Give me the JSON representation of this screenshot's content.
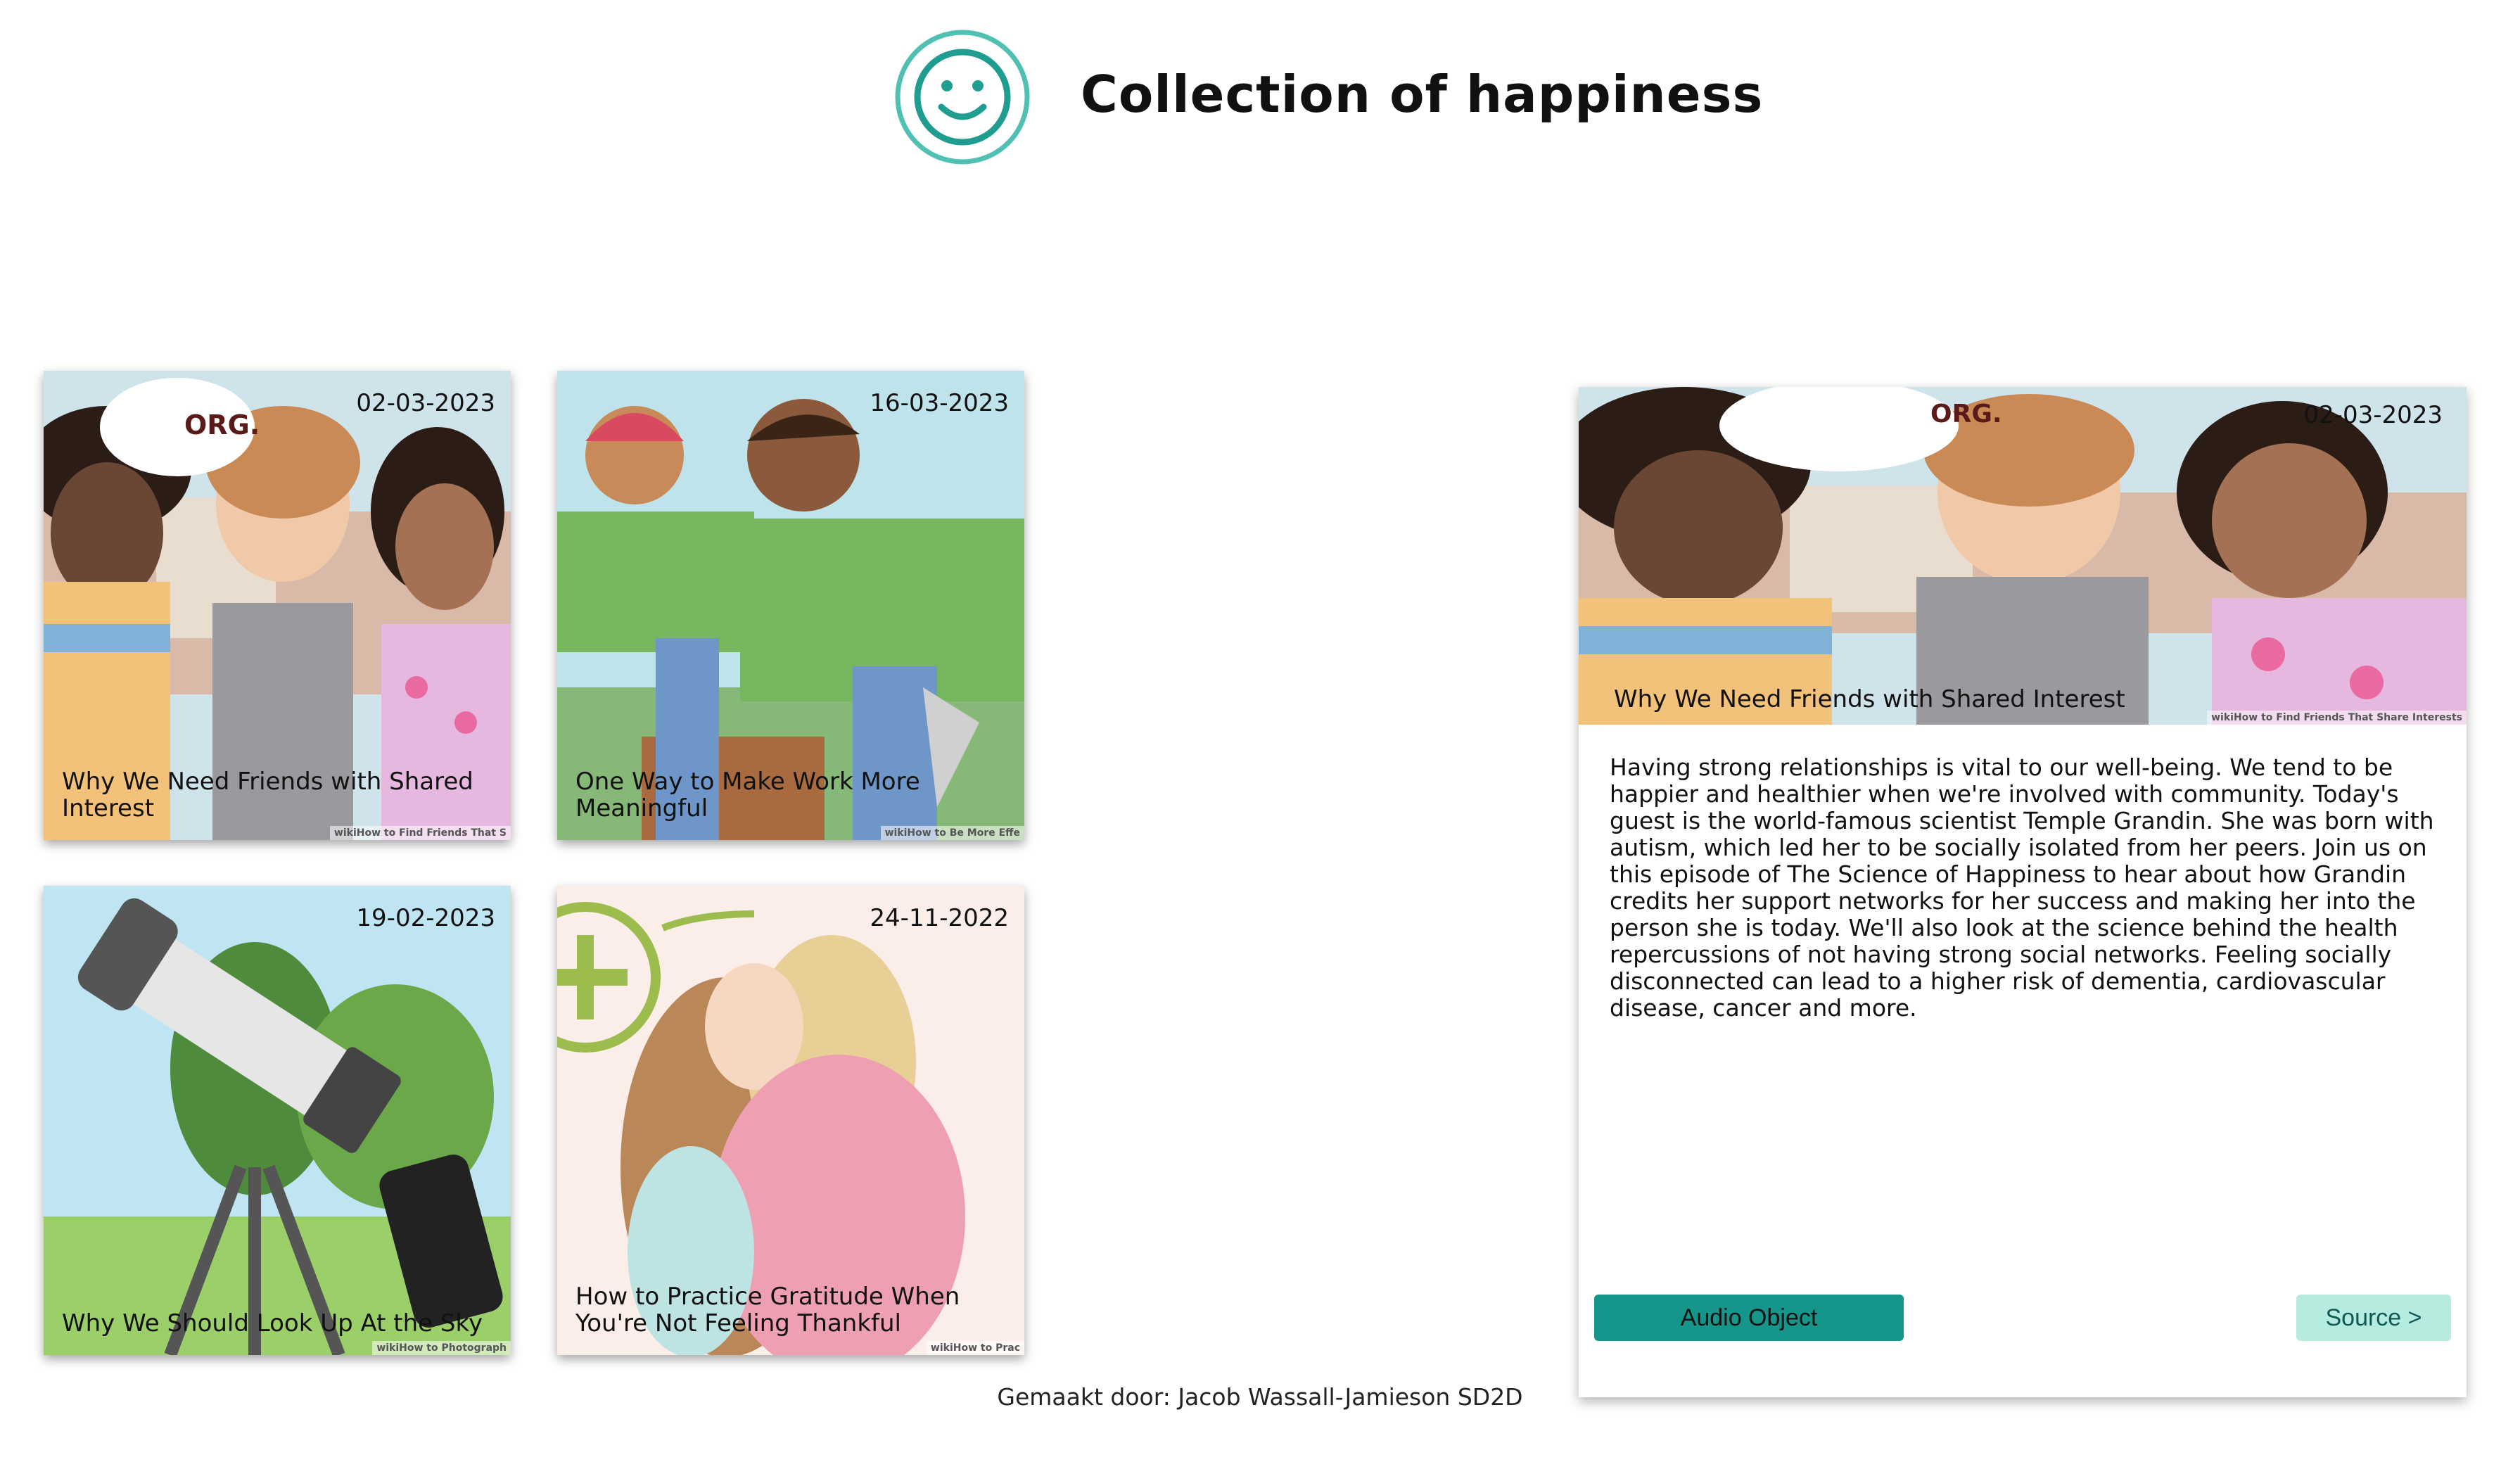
{
  "header": {
    "title": "Collection of happiness",
    "logo_icon": "smiley-face-icon",
    "accent_color": "#1e9d90"
  },
  "cards": [
    {
      "date": "02-03-2023",
      "title": "Why We Need Friends with Shared Interest",
      "watermark": "wikiHow to Find Friends That S"
    },
    {
      "date": "16-03-2023",
      "title": "One Way to Make Work More Meaningful",
      "watermark": "wikiHow to Be More Effe"
    },
    {
      "date": "19-02-2023",
      "title": "Why We Should Look Up At the Sky",
      "watermark": "wikiHow to Photograph"
    },
    {
      "date": "24-11-2022",
      "title": "How to Practice Gratitude When You're Not Feeling Thankful",
      "watermark": "wikiHow to Prac"
    }
  ],
  "detail": {
    "date": "02-03-2023",
    "title": "Why We Need Friends with Shared Interest",
    "watermark": "wikiHow to Find Friends That Share Interests",
    "description": "Having strong relationships is vital to our well-being. We tend to be happier and healthier when we're involved with community. Today's guest is the world-famous scientist Temple Grandin. She was born with autism, which led her to be socially isolated from her peers. Join us on this episode of The Science of Happiness to hear about how Grandin credits her support networks for her success and making her into the person she is today. We'll also look at the science behind the health repercussions of not having strong social networks. Feeling socially disconnected can lead to a higher risk of dementia, cardiovascular disease, cancer and more.",
    "audio_label": "Audio Object",
    "source_label": "Source >"
  },
  "footer": {
    "credit": "Gemaakt door: Jacob Wassall-Jamieson SD2D"
  }
}
